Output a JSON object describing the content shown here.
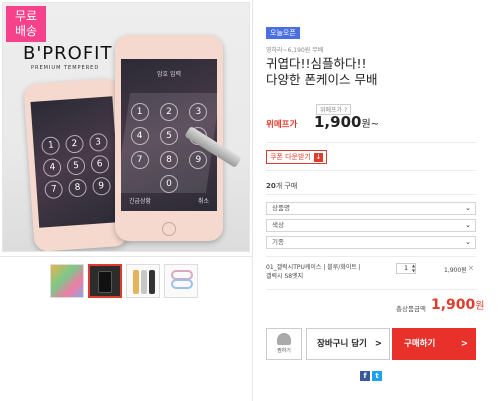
{
  "badge": {
    "line1": "무료",
    "line2": "배송"
  },
  "brand": {
    "name": "B'PROFIT",
    "tagline": "PREMIUM TEMPERED"
  },
  "phone_screen": {
    "title": "암호 입력",
    "keys": [
      "1",
      "2",
      "3",
      "4",
      "5",
      "6",
      "7",
      "8",
      "9",
      "0"
    ],
    "bottom_left": "긴급상황",
    "bottom_right": "취소"
  },
  "product": {
    "tag": "오늘오픈",
    "subtitle": "영하라~6,190원 무배",
    "title_line1": "귀엽다!!심플하다!!",
    "title_line2": "다양한 폰케이스 무배",
    "discount_label": "위메프가 ?",
    "price_label": "위메프가",
    "price": "1,900",
    "price_unit": "원~",
    "coupon_label": "쿠폰 다운받기",
    "coupon_icon": "download-icon",
    "sold_count": "20",
    "sold_suffix": "개 구매"
  },
  "options": {
    "select1": "상품명",
    "select2": "색상",
    "select3": "기종"
  },
  "selected_option": {
    "name": "01_갤럭시TPU케이스 | 블루/화이트 | 갤럭시 S8엣지",
    "qty": "1",
    "price": "1,900원",
    "remove": "×"
  },
  "total": {
    "label": "총상품금액",
    "amount": "1,900",
    "unit": "원"
  },
  "buttons": {
    "like": "찜하기",
    "cart": "장바구니 담기",
    "buy": "구매하기",
    "arrow": ">"
  },
  "share": {
    "facebook": "f",
    "twitter": "t"
  },
  "colors": {
    "accent": "#e8312a",
    "badge": "#f5428a",
    "tag": "#4b6ee0"
  }
}
